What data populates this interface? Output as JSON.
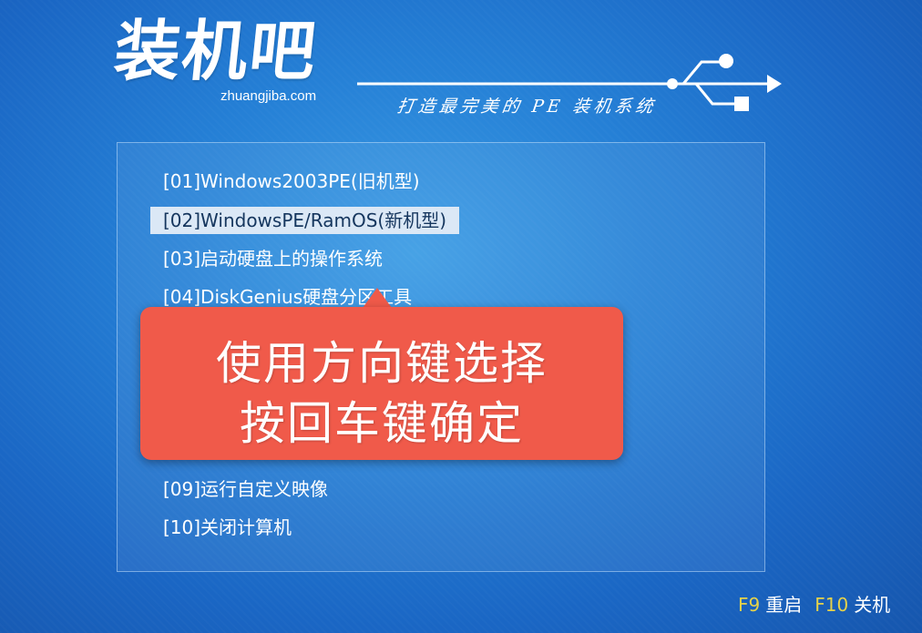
{
  "header": {
    "logo_title": "装机吧",
    "logo_domain": "zhuangjiba.com",
    "slogan": "打造最完美的 PE 装机系统"
  },
  "menu": {
    "items": [
      {
        "label": "[01]Windows2003PE(旧机型)",
        "selected": false
      },
      {
        "label": "[02]WindowsPE/RamOS(新机型)",
        "selected": true
      },
      {
        "label": "[03]启动硬盘上的操作系统",
        "selected": false
      },
      {
        "label": "[04]DiskGenius硬盘分区工具",
        "selected": false
      },
      {
        "label": "[09]运行自定义映像",
        "selected": false
      },
      {
        "label": "[10]关闭计算机",
        "selected": false
      }
    ]
  },
  "callout": {
    "line1": "使用方向键选择",
    "line2": "按回车键确定"
  },
  "function_keys": [
    {
      "key": "F9",
      "label": "重启"
    },
    {
      "key": "F10",
      "label": "关机"
    }
  ],
  "colors": {
    "background": "#2580d6",
    "selected_item_bg": "#dbe8f6",
    "callout_bg": "#f05a4a",
    "fkey_code": "#e6d24a"
  }
}
